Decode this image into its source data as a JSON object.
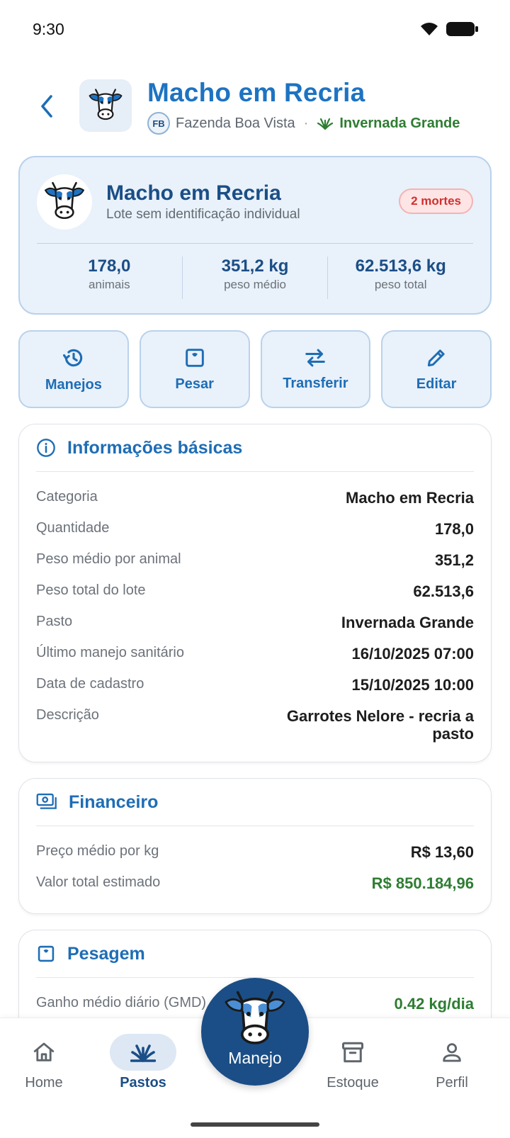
{
  "status_bar": {
    "time": "9:30"
  },
  "header": {
    "title": "Macho em Recria",
    "farm_initials": "FB",
    "farm_name": "Fazenda Boa Vista",
    "separator": "·",
    "pasture_name": "Invernada Grande"
  },
  "summary": {
    "title": "Macho em Recria",
    "subtitle": "Lote sem identificação individual",
    "deaths_badge": "2 mortes",
    "stats": [
      {
        "value": "178,0",
        "label": "animais"
      },
      {
        "value": "351,2 kg",
        "label": "peso médio"
      },
      {
        "value": "62.513,6 kg",
        "label": "peso total"
      }
    ]
  },
  "actions": [
    {
      "label": "Manejos",
      "icon": "history-icon"
    },
    {
      "label": "Pesar",
      "icon": "scale-icon"
    },
    {
      "label": "Transferir",
      "icon": "transfer-icon"
    },
    {
      "label": "Editar",
      "icon": "pencil-icon"
    }
  ],
  "info_card": {
    "title": "Informações básicas",
    "rows": [
      {
        "label": "Categoria",
        "value": "Macho em Recria"
      },
      {
        "label": "Quantidade",
        "value": "178,0"
      },
      {
        "label": "Peso médio por animal",
        "value": "351,2"
      },
      {
        "label": "Peso total do lote",
        "value": "62.513,6"
      },
      {
        "label": "Pasto",
        "value": "Invernada Grande"
      },
      {
        "label": "Último manejo sanitário",
        "value": "16/10/2025 07:00"
      },
      {
        "label": "Data de cadastro",
        "value": "15/10/2025 10:00"
      },
      {
        "label": "Descrição",
        "value": "Garrotes Nelore - recria a pasto"
      }
    ]
  },
  "finance_card": {
    "title": "Financeiro",
    "rows": [
      {
        "label": "Preço médio por kg",
        "value": "R$ 13,60"
      },
      {
        "label": "Valor total estimado",
        "value": "R$ 850.184,96"
      }
    ]
  },
  "weighing_card": {
    "title": "Pesagem",
    "rows": [
      {
        "label": "Ganho médio diário (GMD)",
        "value": "0.42 kg/dia"
      }
    ]
  },
  "bottom_nav": {
    "items": [
      {
        "label": "Home",
        "icon": "home-icon"
      },
      {
        "label": "Pastos",
        "icon": "grass-icon",
        "active": true
      },
      {
        "label": "Estoque",
        "icon": "archive-icon"
      },
      {
        "label": "Perfil",
        "icon": "person-icon"
      }
    ],
    "fab_label": "Manejo"
  },
  "colors": {
    "primary": "#1b4e86",
    "accent_blue": "#1e6db5",
    "green": "#2e7d32",
    "danger": "#d32f2f",
    "card_tint": "#e9f1fa"
  }
}
